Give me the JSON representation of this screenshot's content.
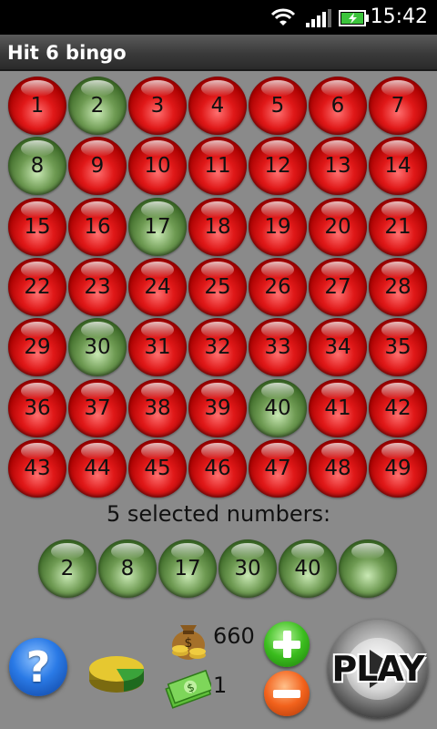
{
  "status_bar": {
    "time": "15:42",
    "icons": [
      "wifi-icon",
      "signal-icon",
      "battery-charging-icon"
    ]
  },
  "app": {
    "title": "Hit 6 bingo"
  },
  "board": {
    "numbers": [
      1,
      2,
      3,
      4,
      5,
      6,
      7,
      8,
      9,
      10,
      11,
      12,
      13,
      14,
      15,
      16,
      17,
      18,
      19,
      20,
      21,
      22,
      23,
      24,
      25,
      26,
      27,
      28,
      29,
      30,
      31,
      32,
      33,
      34,
      35,
      36,
      37,
      38,
      39,
      40,
      41,
      42,
      43,
      44,
      45,
      46,
      47,
      48,
      49
    ],
    "selected": [
      2,
      8,
      17,
      30,
      40
    ],
    "colors": {
      "unselected": "#d81414",
      "selected": "#5a8a40"
    }
  },
  "selection": {
    "label": "5 selected numbers:",
    "slots": [
      "2",
      "8",
      "17",
      "30",
      "40",
      ""
    ]
  },
  "controls": {
    "money": "660",
    "bet": "1",
    "play_label": "PLAY",
    "help_label": "?",
    "icons": [
      "help-icon",
      "stats-pie-icon",
      "money-bag-icon",
      "cash-icon",
      "plus-icon",
      "minus-icon",
      "play-icon"
    ]
  }
}
